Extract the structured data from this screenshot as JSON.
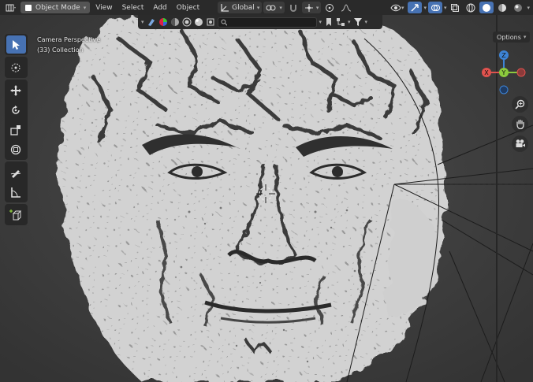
{
  "header": {
    "mode_label": "Object Mode",
    "menus": [
      "View",
      "Select",
      "Add",
      "Object"
    ],
    "orientation_label": "Global"
  },
  "search": {
    "value": ""
  },
  "viewport": {
    "camera_label": "Camera Perspective",
    "collection_label": "(33) Collection",
    "options_label": "Options"
  },
  "gizmo": {
    "x_label": "X",
    "y_label": "Y",
    "z_label": "Z"
  },
  "colors": {
    "accent": "#4772b3",
    "header_bg": "#2a2a2a",
    "axis_x": "#e0524e",
    "axis_y": "#8cc93d",
    "axis_z": "#3d84d6"
  }
}
